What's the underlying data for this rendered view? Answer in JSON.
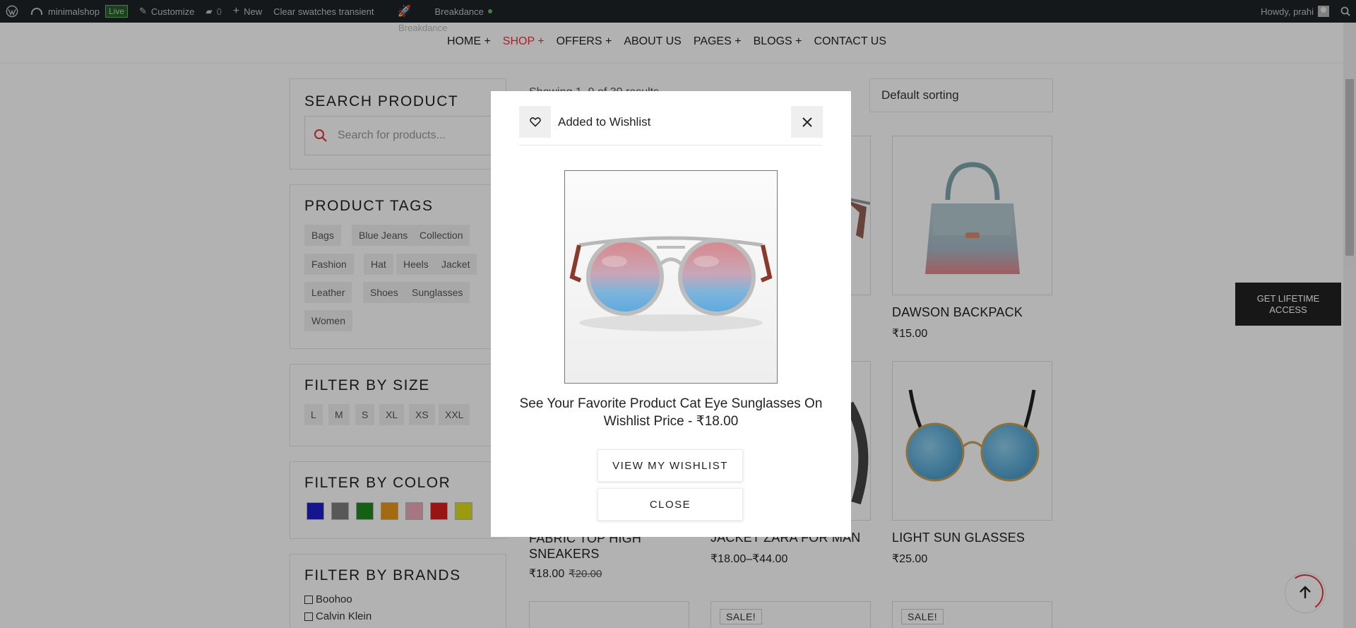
{
  "adminbar": {
    "site_name": "minimalshop",
    "live_badge": "Live",
    "customize": "Customize",
    "comments_count": "0",
    "new_label": "New",
    "clear_swatches": "Clear swatches transient",
    "breakdance": "Breakdance",
    "howdy": "Howdy, prahi"
  },
  "nav": {
    "ghost_label": "Breakdance",
    "items": [
      "HOME +",
      "SHOP +",
      "OFFERS +",
      "ABOUT US",
      "PAGES +",
      "BLOGS +",
      "CONTACT US"
    ],
    "active_index": 1
  },
  "sidebar": {
    "search": {
      "title": "SEARCH PRODUCT",
      "placeholder": "Search for products..."
    },
    "tags": {
      "title": "PRODUCT TAGS",
      "items": [
        "Bags",
        "Blue Jeans",
        "Collection",
        "Fashion",
        "Hat",
        "Heels",
        "Jacket",
        "Leather",
        "Shoes",
        "Sunglasses",
        "Women"
      ]
    },
    "sizes": {
      "title": "FILTER BY SIZE",
      "items": [
        "L",
        "M",
        "S",
        "XL",
        "XS",
        "XXL"
      ]
    },
    "colors": {
      "title": "FILTER BY COLOR",
      "swatches": [
        "#1f1fd1",
        "#7f7f7f",
        "#1f8a1f",
        "#e89a1c",
        "#f0a9bc",
        "#d91f1f",
        "#dede1c"
      ]
    },
    "brands": {
      "title": "FILTER BY BRANDS",
      "items": [
        "Boohoo",
        "Calvin Klein"
      ]
    }
  },
  "shop": {
    "result_count": "Showing 1–9 of 30 results",
    "sorting": "Default sorting",
    "products": [
      {
        "title": "DAWSON BACKPACK",
        "price": "₹15.00"
      },
      {
        "title": "FABRIC TOP HIGH SNEAKERS",
        "price": "₹18.00",
        "old_price": "₹20.00"
      },
      {
        "title": "JACKET ZARA FOR MAN",
        "price": "₹18.00–₹44.00"
      },
      {
        "title": "LIGHT SUN GLASSES",
        "price": "₹25.00"
      }
    ],
    "sale_label": "SALE!"
  },
  "lifetime_cta": "GET LIFETIME ACCESS",
  "modal": {
    "title": "Added to Wishlist",
    "message": "See Your Favorite Product Cat Eye Sunglasses On Wishlist Price - ₹18.00",
    "view_button": "VIEW MY WISHLIST",
    "close_button": "CLOSE"
  },
  "colors": {
    "accent": "#e2353b",
    "adminbar": "#1d2327"
  }
}
